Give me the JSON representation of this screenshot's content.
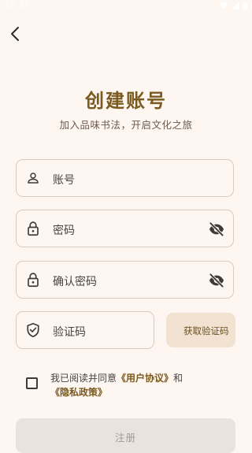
{
  "status_bar": {
    "time": "10:33",
    "icons": [
      "wifi-icon",
      "signal-icon",
      "battery-icon"
    ]
  },
  "header": {
    "back_icon": "chevron-left-icon",
    "title": "创建账号",
    "subtitle": "加入品味书法，开启文化之旅"
  },
  "form": {
    "account": {
      "placeholder": "账号",
      "icon": "person-icon"
    },
    "password": {
      "placeholder": "密码",
      "icon": "lock-icon",
      "toggle_icon": "eye-off-icon"
    },
    "confirm_password": {
      "placeholder": "确认密码",
      "icon": "lock-icon",
      "toggle_icon": "eye-off-icon"
    },
    "verification_code": {
      "placeholder": "验证码",
      "icon": "shield-check-icon"
    },
    "get_code_label": "获取验证码"
  },
  "agreement": {
    "prefix": "我已阅读并同意",
    "user_agreement": "《用户协议》",
    "conjunction": "和",
    "privacy_policy": "《隐私政策》",
    "checked": false
  },
  "register_label": "注册",
  "colors": {
    "background": "#FDF6F1",
    "accent": "#7A5A1E",
    "field_border": "#D9CBC2",
    "code_button_bg": "#F1E2D2",
    "disabled_button_bg": "#E9E3DF"
  }
}
